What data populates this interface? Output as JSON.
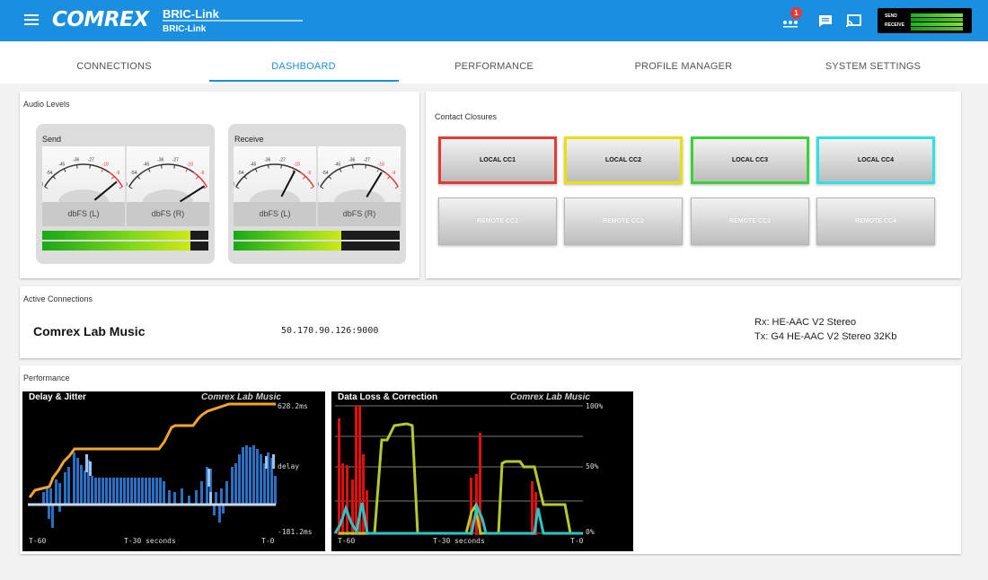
{
  "header": {
    "logo": "COMREX",
    "title": "BRIC-Link",
    "subtitle": "BRIC-Link",
    "notification_count": "1",
    "meter": {
      "send_label": "SEND",
      "receive_label": "RECEIVE"
    }
  },
  "tabs": [
    {
      "label": "CONNECTIONS"
    },
    {
      "label": "DASHBOARD"
    },
    {
      "label": "PERFORMANCE"
    },
    {
      "label": "PROFILE MANAGER"
    },
    {
      "label": "SYSTEM SETTINGS"
    }
  ],
  "active_tab": "DASHBOARD",
  "audio_levels": {
    "title": "Audio Levels",
    "scale_labels": [
      "-63",
      "-54",
      "-45",
      "-36",
      "-27",
      "-18",
      "-9",
      "0"
    ],
    "send": {
      "label": "Send",
      "left_caption": "dbFS (L)",
      "right_caption": "dbFS (R)",
      "level": 0.89
    },
    "receive": {
      "label": "Receive",
      "left_caption": "dbFS (L)",
      "right_caption": "dbFS (R)",
      "level": 0.65
    }
  },
  "contact_closures": {
    "title": "Contact Closures",
    "local": [
      {
        "label": "LOCAL CC1",
        "color": "#e53935"
      },
      {
        "label": "LOCAL CC2",
        "color": "#e8e000"
      },
      {
        "label": "LOCAL CC3",
        "color": "#3ad13a"
      },
      {
        "label": "LOCAL CC4",
        "color": "#2ee0e8"
      }
    ],
    "remote": [
      {
        "label": "REMOTE CC1"
      },
      {
        "label": "REMOTE CC2"
      },
      {
        "label": "REMOTE CC3"
      },
      {
        "label": "REMOTE CC4"
      }
    ]
  },
  "active_connections": {
    "title": "Active Connections",
    "name": "Comrex Lab Music",
    "address": "50.170.90.126:9000",
    "rx": "Rx: HE-AAC V2 Stereo",
    "tx": "Tx: G4 HE-AAC V2 Stereo 32Kb"
  },
  "performance": {
    "title": "Performance",
    "delay_graph": {
      "title": "Delay & Jitter",
      "source": "Comrex Lab Music",
      "top_label": "628.2ms",
      "mid_label": "delay",
      "bottom_label": "-181.2ms",
      "x_start": "T-60",
      "x_mid": "T-30 seconds",
      "x_end": "T-0"
    },
    "loss_graph": {
      "title": "Data Loss & Correction",
      "source": "Comrex Lab Music",
      "y_labels": [
        "100%",
        "50%",
        "0%"
      ],
      "x_start": "T-60",
      "x_mid": "T-30 seconds",
      "x_end": "T-0"
    }
  }
}
